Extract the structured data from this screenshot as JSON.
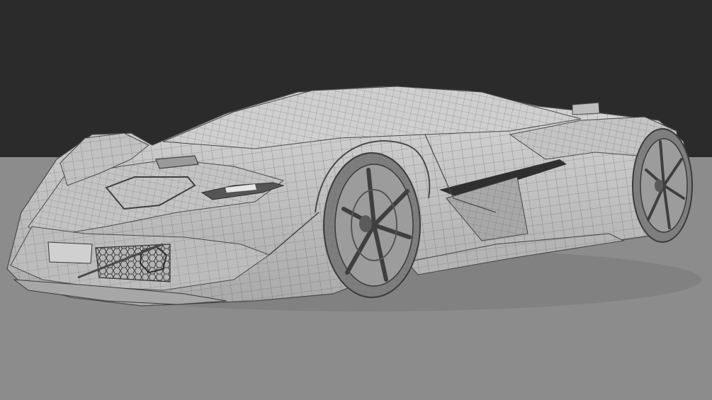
{
  "viewport": {
    "shading_mode": "wireframe-on-shaded",
    "colors": {
      "background": "#2b2b2b",
      "floor": "#8c8c8c",
      "body": "#c9c9c9",
      "body_shadow": "#9d9d9d",
      "wire": "#5a5a5a",
      "dark": "#333333",
      "wheel": "#7e7e7e"
    }
  }
}
